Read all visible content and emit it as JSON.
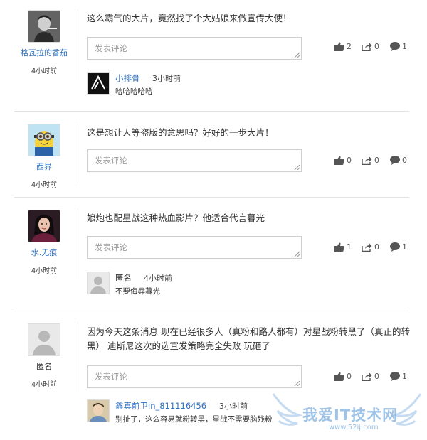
{
  "comments": [
    {
      "user": "格瓦拉的香茄",
      "time": "4小时前",
      "text": "这么霸气的大片，竟然找了个大姑娘来做宣传大使！",
      "placeholder": "发表评论",
      "likes": "2",
      "shares": "0",
      "replies": "1",
      "reply": {
        "user": "小排骨",
        "time": "3小时前",
        "text": "哈哈哈哈哈"
      }
    },
    {
      "user": "西界",
      "time": "4小时前",
      "text": "这是想让人等盗版的意思吗？好好的一步大片！",
      "placeholder": "发表评论",
      "likes": "0",
      "shares": "0",
      "replies": "0"
    },
    {
      "user": "水.无痕",
      "time": "4小时前",
      "text": "娘炮也配星战这种热血影片？他适合代言暮光",
      "placeholder": "发表评论",
      "likes": "1",
      "shares": "0",
      "replies": "1",
      "reply": {
        "user": "匿名",
        "time": "4小时前",
        "text": "不要侮辱暮光"
      }
    },
    {
      "user": "匿名",
      "time": "4小时前",
      "text_line1": "因为今天这条消息 现在已经很多人（真粉和路人都有）对星战粉转黑了（真正的转",
      "text_line2": "黑） 迪斯尼这次的选宣发策略完全失败 玩砸了",
      "placeholder": "发表评论",
      "likes": "0",
      "shares": "0",
      "replies": "1",
      "reply": {
        "user": "鑫真前卫in_811116456",
        "time": "3小时前",
        "text": "别扯了，这么容易就粉转黑，星战不需要脑残粉"
      }
    }
  ],
  "watermark": {
    "title": "我爱IT技术网",
    "url": "www.52ij.com"
  },
  "colors": {
    "link": "#2f6fbf",
    "border": "#cfcfcf",
    "separator": "#e3e3e3",
    "icon": "#555555"
  },
  "icons": [
    "thumbs-up-icon",
    "share-icon",
    "speech-bubble-icon"
  ]
}
